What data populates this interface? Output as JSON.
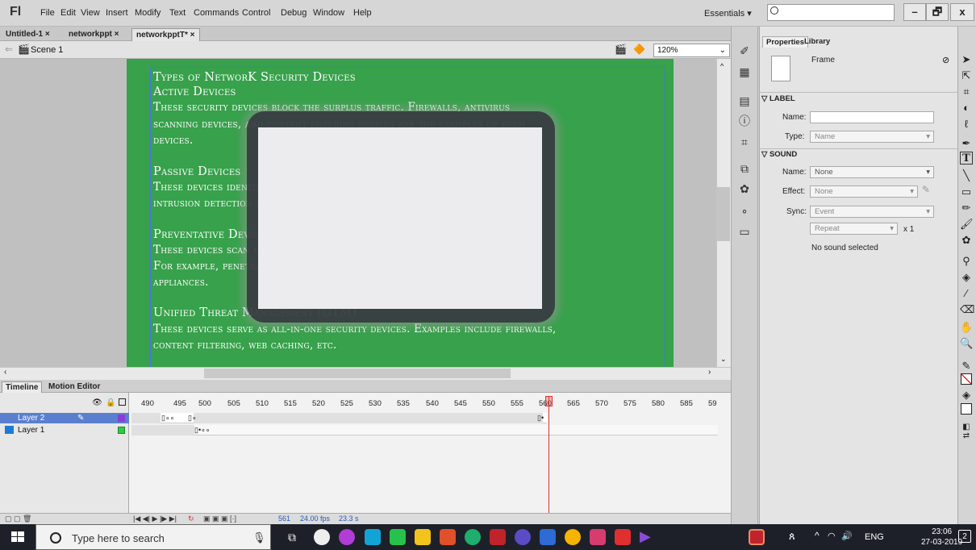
{
  "menubar": {
    "logo": "Fl",
    "items": [
      "File",
      "Edit",
      "View",
      "Insert",
      "Modify",
      "Text",
      "Commands",
      "Control",
      "Debug",
      "Window",
      "Help"
    ],
    "workspace": "Essentials ▾",
    "search_placeholder": "",
    "window_buttons": [
      "–",
      "🗗",
      "x"
    ]
  },
  "doc_tabs": [
    "Untitled-1 ×",
    "networkppt ×",
    "networkpptT* ×"
  ],
  "edit_bar": {
    "scene": "Scene 1",
    "zoom": "120%"
  },
  "slide": {
    "lines": [
      "Types of NetworK Security Devices",
      "Active Devices",
      "These security devices block the surplus traffic. Firewalls, antivirus",
      "scanning devices, and content filtering devices are the examples of such",
      "devices.",
      "Passive Devices",
      "These devices identify and report on unwanted traffic, for example,",
      "intrusion detection appliances.",
      "Preventative Devices",
      "These devices scan the networks and identify potential security problems.",
      "For example, penetration testing devices and vulnerability assessment",
      "appliances.",
      "Unified Threat Management (UTM)",
      "These devices serve as all-in-one security devices. Examples include firewalls,",
      "content filtering, web caching, etc."
    ]
  },
  "timeline": {
    "tabs": [
      "Timeline",
      "Motion Editor"
    ],
    "frame_numbers": [
      "490",
      "495",
      "500",
      "505",
      "510",
      "515",
      "520",
      "525",
      "530",
      "535",
      "540",
      "545",
      "550",
      "555",
      "560",
      "565",
      "570",
      "575",
      "580",
      "585",
      "59"
    ],
    "layers": [
      {
        "name": "Layer 2",
        "selected": true,
        "color": "#8c3cd6"
      },
      {
        "name": "Layer 1",
        "selected": false,
        "color": "#2ecc40"
      }
    ],
    "footer": {
      "current_frame": "561",
      "fps": "24.00 fps",
      "time": "23.3 s"
    }
  },
  "properties": {
    "tabs": [
      "Properties",
      "Library"
    ],
    "object_type": "Frame",
    "label_section": "LABEL",
    "name_label": "Name:",
    "name_value": "",
    "type_label": "Type:",
    "type_value": "Name",
    "sound_section": "SOUND",
    "sound_name_label": "Name:",
    "sound_name_value": "None",
    "effect_label": "Effect:",
    "effect_value": "None",
    "sync_label": "Sync:",
    "sync_value": "Event",
    "repeat_value": "Repeat",
    "repeat_count": "x 1",
    "status": "No sound selected"
  },
  "taskbar": {
    "search_placeholder": "Type here to search",
    "language": "ENG",
    "time": "23:06",
    "date": "27-03-2019",
    "notifications": "2"
  }
}
